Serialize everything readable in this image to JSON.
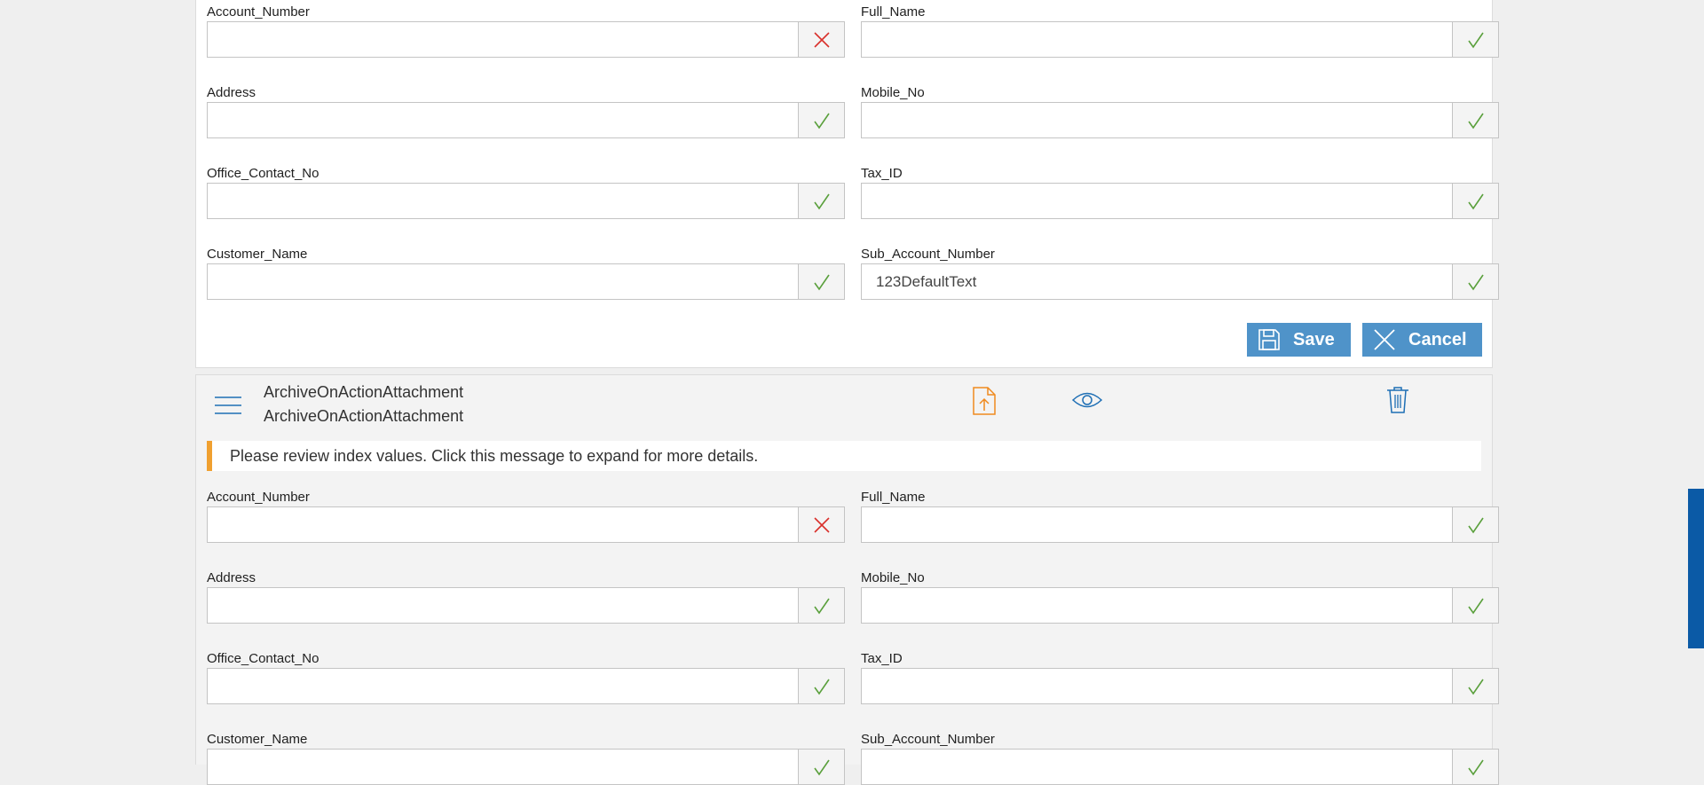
{
  "form_top": {
    "fields": [
      {
        "label": "Account_Number",
        "value": "",
        "status": "error"
      },
      {
        "label": "Full_Name",
        "value": "",
        "status": "ok"
      },
      {
        "label": "Address",
        "value": "",
        "status": "ok"
      },
      {
        "label": "Mobile_No",
        "value": "",
        "status": "ok"
      },
      {
        "label": "Office_Contact_No",
        "value": "",
        "status": "ok"
      },
      {
        "label": "Tax_ID",
        "value": "",
        "status": "ok"
      },
      {
        "label": "Customer_Name",
        "value": "",
        "status": "ok"
      },
      {
        "label": "Sub_Account_Number",
        "value": "123DefaultText",
        "status": "ok"
      }
    ],
    "save_label": "Save",
    "cancel_label": "Cancel"
  },
  "attachment": {
    "name_line1": "ArchiveOnActionAttachment",
    "name_line2": "ArchiveOnActionAttachment",
    "notice": "Please review index values. Click this message to expand for more details.",
    "fields": [
      {
        "label": "Account_Number",
        "value": "",
        "status": "error"
      },
      {
        "label": "Full_Name",
        "value": "",
        "status": "ok"
      },
      {
        "label": "Address",
        "value": "",
        "status": "ok"
      },
      {
        "label": "Mobile_No",
        "value": "",
        "status": "ok"
      },
      {
        "label": "Office_Contact_No",
        "value": "",
        "status": "ok"
      },
      {
        "label": "Tax_ID",
        "value": "",
        "status": "ok"
      },
      {
        "label": "Customer_Name",
        "value": "",
        "status": "ok"
      },
      {
        "label": "Sub_Account_Number",
        "value": "",
        "status": "ok"
      }
    ]
  },
  "icons": {
    "ok": "checkmark-icon",
    "error": "x-mark-icon",
    "menu": "hamburger-menu-icon",
    "upload": "upload-file-icon",
    "view": "eye-icon",
    "delete": "trash-icon",
    "save": "floppy-disk-icon",
    "cancel": "close-icon"
  },
  "colors": {
    "ok": "#5aa03c",
    "error": "#d9312c",
    "button": "#4f93c9",
    "notice_accent": "#f0a030",
    "icon_blue": "#1e6fb5",
    "upload_orange": "#f08a1e",
    "scrollbar": "#0b5aa6"
  }
}
